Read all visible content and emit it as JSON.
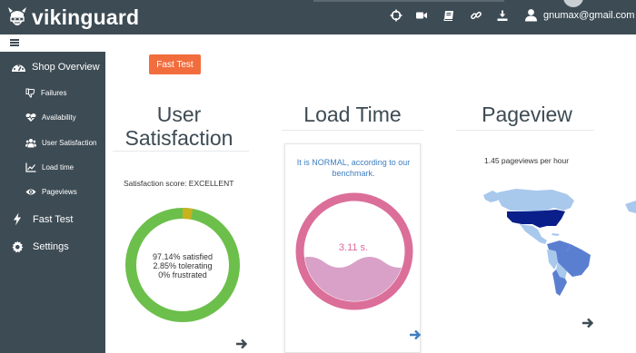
{
  "app": {
    "name": "vikinguard"
  },
  "header": {
    "user_email": "gnumax@gmail.com",
    "icons": [
      "crosshair-icon",
      "video-icon",
      "book-icon",
      "link-icon",
      "download-icon",
      "user-icon"
    ]
  },
  "sidebar": {
    "items": [
      {
        "label": "Shop Overview",
        "icon": "dashboard-icon"
      },
      {
        "label": "Failures",
        "icon": "thumbs-down-icon"
      },
      {
        "label": "Availability",
        "icon": "heartbeat-icon"
      },
      {
        "label": "User Satisfaction",
        "icon": "users-icon"
      },
      {
        "label": "Load time",
        "icon": "line-chart-icon"
      },
      {
        "label": "Pageviews",
        "icon": "eye-icon"
      },
      {
        "label": "Fast Test",
        "icon": "bolt-icon"
      },
      {
        "label": "Settings",
        "icon": "gear-icon"
      }
    ]
  },
  "toolbar": {
    "fast_test_label": "Fast Test"
  },
  "panels": {
    "satisfaction": {
      "title_line1": "User",
      "title_line2": "Satisfaction",
      "score_text": "Satisfaction score: EXCELLENT",
      "satisfied": "97.14% satisfied",
      "tolerating": "2.85% tolerating",
      "frustrated": "0% frustrated",
      "satisfied_pct": 97.14,
      "tolerating_pct": 2.85,
      "frustrated_pct": 0
    },
    "load_time": {
      "title": "Load Time",
      "note": "It is NORMAL, according to our benchmark.",
      "value": "3.11 s."
    },
    "pageview": {
      "title": "Pageview",
      "rate_text": "1.45 pageviews per hour"
    }
  },
  "colors": {
    "topbar": "#3d4b54",
    "accent_button": "#f26d3d",
    "satisfied": "#6cbf4b",
    "tolerating": "#c8b21e",
    "load_ring": "#db6f99",
    "load_fill": "#d9a1c8",
    "map_dark": "#0b1f8a",
    "map_medium": "#5b7fd0",
    "map_light": "#a8c8ec",
    "link_blue": "#3f7fbf"
  }
}
